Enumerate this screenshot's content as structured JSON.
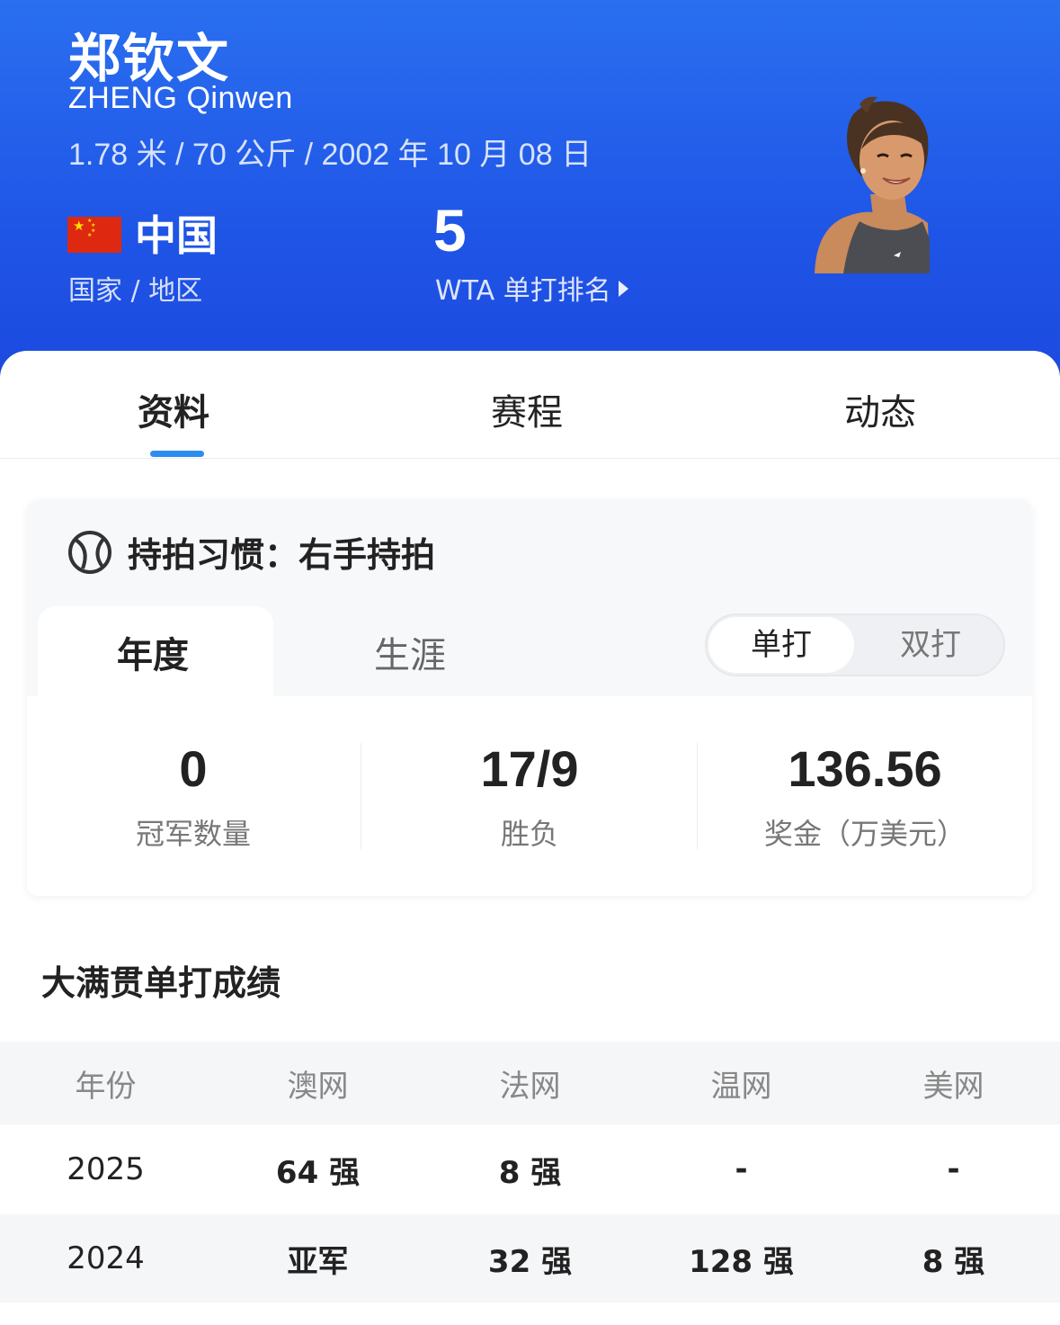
{
  "player": {
    "name_cn": "郑钦文",
    "name_en": "ZHENG Qinwen",
    "bio": "1.78 米 / 70 公斤 / 2002 年 10 月 08 日",
    "country": "中国",
    "country_label": "国家 / 地区",
    "rank": "5",
    "rank_label": "WTA 单打排名"
  },
  "tabs": {
    "items": [
      "资料",
      "赛程",
      "动态"
    ],
    "active": "资料"
  },
  "profile": {
    "grip": "持拍习惯：右手持拍",
    "period_tabs": [
      "年度",
      "生涯"
    ],
    "active_period": "年度",
    "type_toggle": [
      "单打",
      "双打"
    ],
    "active_type": "单打",
    "stats": [
      {
        "value": "0",
        "label": "冠军数量"
      },
      {
        "value": "17/9",
        "label": "胜负"
      },
      {
        "value": "136.56",
        "label": "奖金（万美元）"
      }
    ]
  },
  "grand_slam": {
    "title": "大满贯单打成绩",
    "columns": [
      "年份",
      "澳网",
      "法网",
      "温网",
      "美网"
    ],
    "rows": [
      [
        "2025",
        "64 强",
        "8 强",
        "-",
        "-"
      ],
      [
        "2024",
        "亚军",
        "32 强",
        "128 强",
        "8 强"
      ]
    ]
  },
  "colors": {
    "header_blue": "#1f55e6",
    "tab_indicator": "#2d8cf0"
  }
}
